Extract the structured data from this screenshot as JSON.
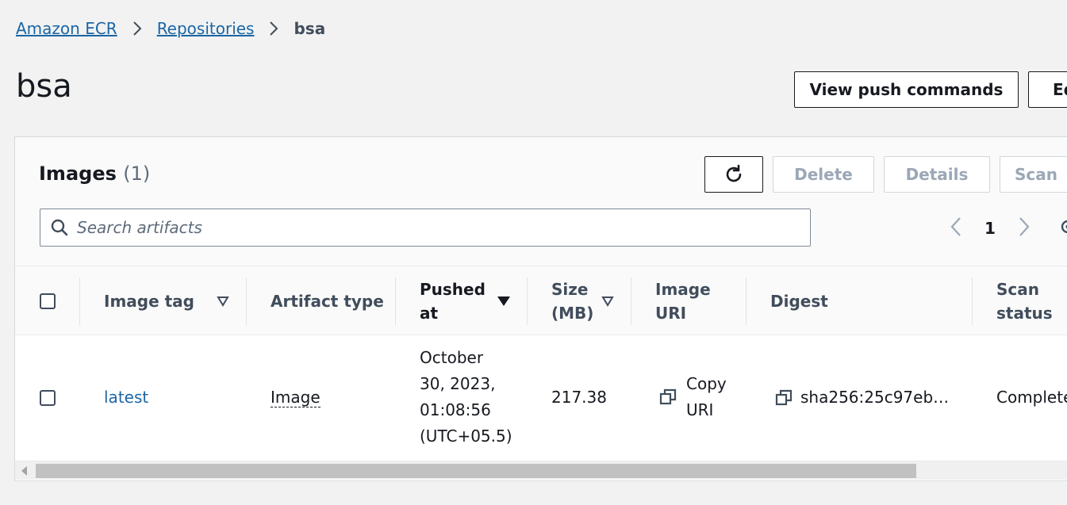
{
  "breadcrumb": {
    "items": [
      "Amazon ECR",
      "Repositories"
    ],
    "current": "bsa"
  },
  "page": {
    "title": "bsa"
  },
  "header_actions": {
    "view_push_commands": "View push commands",
    "edit": "Edit"
  },
  "images_panel": {
    "title": "Images",
    "count": "(1)",
    "actions": {
      "delete": "Delete",
      "details": "Details",
      "scan": "Scan"
    },
    "search": {
      "placeholder": "Search artifacts",
      "value": ""
    },
    "pagination": {
      "current_page": "1"
    },
    "table": {
      "columns": [
        "Image tag",
        "Artifact type",
        "Pushed at",
        "Size (MB)",
        "Image URI",
        "Digest",
        "Scan status"
      ],
      "column_lines": {
        "pushed_at": [
          "Pushed",
          "at"
        ],
        "size": [
          "Size",
          "(MB)"
        ],
        "image_uri": [
          "Image",
          "URI"
        ],
        "scan_status": [
          "Scan",
          "status"
        ]
      },
      "rows": [
        {
          "image_tag": "latest",
          "artifact_type": "Image",
          "pushed_at_lines": [
            "October",
            "30, 2023,",
            "01:08:56",
            "(UTC+05.5)"
          ],
          "size": "217.38",
          "image_uri_lines": [
            "Copy",
            "URI"
          ],
          "digest": "sha256:25c97eb…",
          "scan_status": "Complete"
        }
      ]
    }
  },
  "icons": {
    "breadcrumb_separator": "chevron-right-icon",
    "refresh": "refresh-icon",
    "search": "search-icon",
    "prev": "chevron-left-icon",
    "next": "chevron-right-icon",
    "settings": "gear-icon",
    "sort_filter": "caret-down-outline-icon",
    "sort_active": "caret-down-filled-icon",
    "copy": "copy-icon"
  },
  "colors": {
    "link": "#1b66a5",
    "background": "#f2f2f2",
    "panel": "#ffffff",
    "disabled_text": "#9ba7b6"
  }
}
